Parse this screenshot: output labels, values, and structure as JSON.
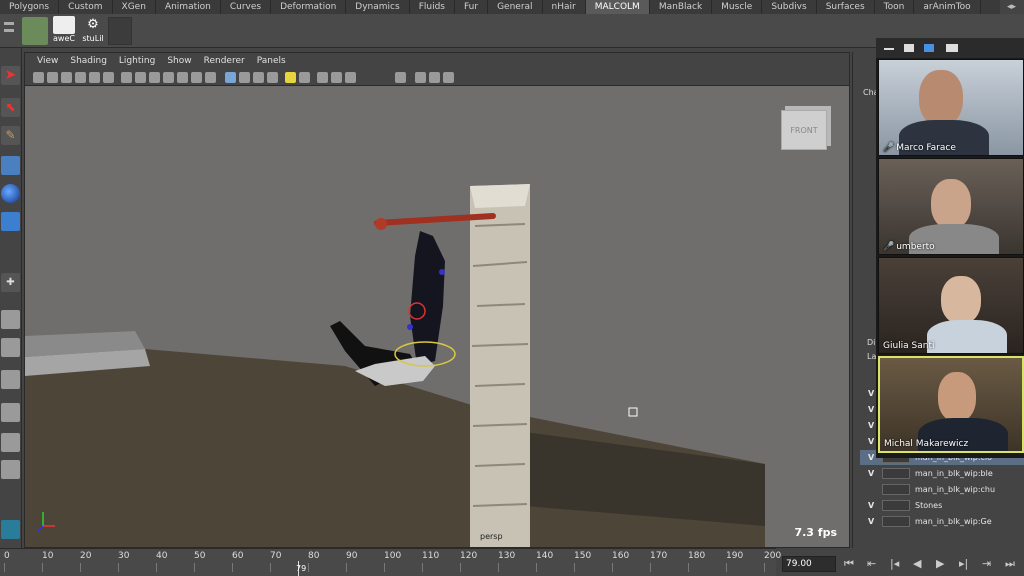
{
  "shelf_tabs": [
    "Polygons",
    "Custom",
    "XGen",
    "Animation",
    "Curves",
    "Deformation",
    "Dynamics",
    "Fluids",
    "Fur",
    "General",
    "nHair",
    "MALCOLM",
    "ManBlack",
    "Muscle",
    "Subdivs",
    "Surfaces",
    "Toon",
    "arAnimToo"
  ],
  "active_shelf_tab": "MALCOLM",
  "shelf_buttons": [
    "aweC",
    "stuLil"
  ],
  "panel_menu": [
    "View",
    "Shading",
    "Lighting",
    "Show",
    "Renderer",
    "Panels"
  ],
  "viewport": {
    "fps": "7.3 fps",
    "camera": "persp",
    "viewcube_label": "FRONT"
  },
  "side_panel_labels": {
    "channel_tab": "Cha",
    "display_tab": "Di",
    "layer_tab": "La"
  },
  "call": {
    "participants": [
      {
        "name": "Marco Farace",
        "muted": true
      },
      {
        "name": "umberto",
        "muted": true
      },
      {
        "name": "Giulia Santi",
        "muted": false
      },
      {
        "name": "Michal Makarewicz",
        "muted": false
      }
    ]
  },
  "layers": [
    {
      "visible": "V",
      "name": ""
    },
    {
      "visible": "V",
      "name": ""
    },
    {
      "visible": "V",
      "name": ""
    },
    {
      "visible": "V",
      "name": ""
    },
    {
      "visible": "V",
      "name": "man_in_blk_wip:clo",
      "selected": true
    },
    {
      "visible": "V",
      "name": "man_in_blk_wip:ble"
    },
    {
      "visible": "",
      "name": "man_in_blk_wip:chu"
    },
    {
      "visible": "V",
      "name": "Stones"
    },
    {
      "visible": "V",
      "name": "man_in_blk_wip:Ge"
    }
  ],
  "timeline": {
    "tick_labels": [
      "0",
      "10",
      "20",
      "30",
      "40",
      "50",
      "60",
      "70",
      "80",
      "90",
      "100",
      "110",
      "120",
      "130",
      "140",
      "150",
      "160",
      "170",
      "180",
      "190",
      "200"
    ],
    "current_frame": "79",
    "frame_field": "79.00"
  },
  "playback_icons": [
    "go-to-start-icon",
    "step-back-key-icon",
    "step-back-frame-icon",
    "play-back-icon",
    "play-forward-icon",
    "step-forward-frame-icon",
    "step-forward-key-icon",
    "go-to-end-icon"
  ],
  "colors": {
    "maya_bg": "#444444",
    "viewport": "#6f6e6d",
    "active_speaker": "#d9e36a",
    "selection": "#5b6e86"
  }
}
